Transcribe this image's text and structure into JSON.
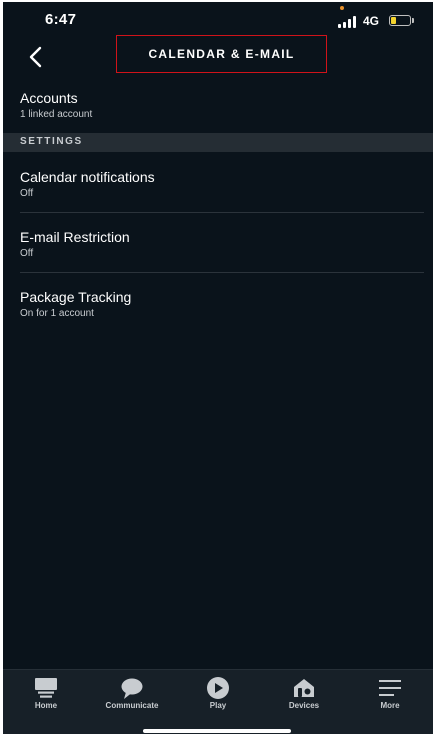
{
  "status_bar": {
    "time": "6:47",
    "network": "4G",
    "battery_level": 0.25,
    "battery_color": "#f3d32e"
  },
  "header": {
    "back_icon": "chevron-left-icon",
    "title": "CALENDAR & E-MAIL"
  },
  "accounts": {
    "title": "Accounts",
    "subtitle": "1 linked account"
  },
  "settings_section": {
    "label": "SETTINGS",
    "items": [
      {
        "title": "Calendar notifications",
        "subtitle": "Off"
      },
      {
        "title": "E-mail Restriction",
        "subtitle": "Off"
      },
      {
        "title": "Package Tracking",
        "subtitle": "On for 1 account"
      }
    ]
  },
  "bottom_nav": {
    "items": [
      {
        "label": "Home",
        "icon": "home-icon"
      },
      {
        "label": "Communicate",
        "icon": "chat-bubble-icon"
      },
      {
        "label": "Play",
        "icon": "play-icon"
      },
      {
        "label": "Devices",
        "icon": "devices-icon"
      },
      {
        "label": "More",
        "icon": "menu-icon"
      }
    ]
  },
  "colors": {
    "background": "#0a131b",
    "section_header_bg": "#252d34",
    "highlight_box": "#d0131a",
    "nav_background": "#172028"
  }
}
